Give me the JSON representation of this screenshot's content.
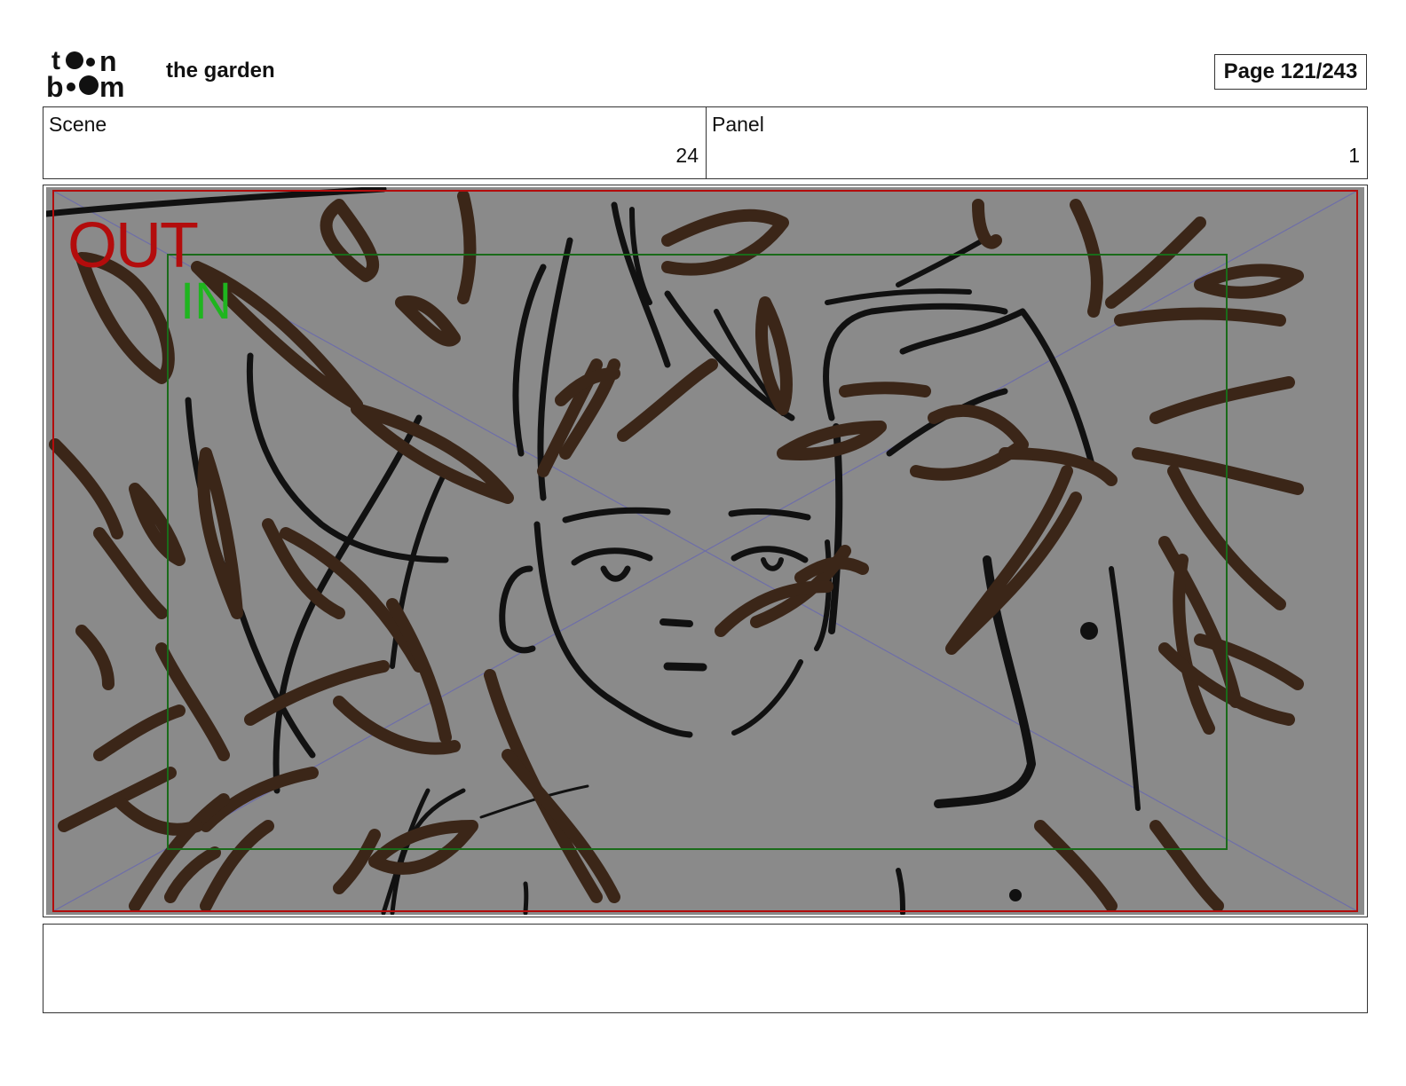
{
  "header": {
    "logo_text": "toon boom",
    "title": "the garden",
    "page_counter": "Page 121/243"
  },
  "info": {
    "scene_label": "Scene",
    "scene_value": "24",
    "panel_label": "Panel",
    "panel_value": "1"
  },
  "panel": {
    "out_label": "OUT",
    "in_label": "IN",
    "colors": {
      "background": "#8a8a8a",
      "outer_frame": "#b30c0c",
      "safe_frame": "#1a6b1a",
      "ink": "#111111",
      "leaf": "#3b2618"
    }
  },
  "notes": {
    "text": ""
  }
}
